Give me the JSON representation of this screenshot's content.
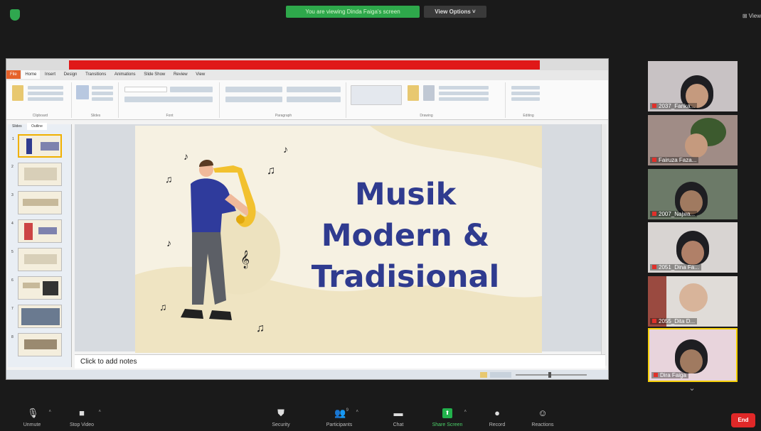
{
  "top": {
    "share_banner": "You are viewing Dinda Faiga's screen",
    "view_options": "View Options ˅",
    "view": "⊞ View"
  },
  "ppt": {
    "ribbon_tabs": [
      "File",
      "Home",
      "Insert",
      "Design",
      "Transitions",
      "Animations",
      "Slide Show",
      "Review",
      "View"
    ],
    "ribbon_groups": [
      "Clipboard",
      "Slides",
      "Font",
      "Paragraph",
      "Drawing",
      "Editing"
    ],
    "thumb_tabs": [
      "Slides",
      "Outline"
    ],
    "slide_numbers": [
      "1",
      "2",
      "3",
      "4",
      "5",
      "6",
      "7",
      "8"
    ],
    "slide_title_lines": [
      "Musik",
      "Modern &",
      "Tradisional"
    ],
    "notes_placeholder": "Click to add notes"
  },
  "participants": [
    {
      "name": "2037_Farika..."
    },
    {
      "name": "Fairuza Faza..."
    },
    {
      "name": "2007_Najwa..."
    },
    {
      "name": "2051_Dina Fa..."
    },
    {
      "name": "2055_Dita D..."
    },
    {
      "name": "Dira Faiga"
    }
  ],
  "toolbar": [
    {
      "label": "Unmute",
      "icon": "microphone-muted-icon",
      "caret": true
    },
    {
      "label": "Stop Video",
      "icon": "video-camera-icon",
      "caret": true
    },
    {
      "label": "Security",
      "icon": "shield-icon",
      "caret": false
    },
    {
      "label": "Participants",
      "icon": "participants-icon",
      "caret": true,
      "count": "9"
    },
    {
      "label": "Chat",
      "icon": "chat-icon",
      "caret": false
    },
    {
      "label": "Share Screen",
      "icon": "share-screen-icon",
      "caret": true
    },
    {
      "label": "Record",
      "icon": "record-icon",
      "caret": false
    },
    {
      "label": "Reactions",
      "icon": "reactions-icon",
      "caret": false
    }
  ],
  "end_label": "End",
  "colors": {
    "slide_title": "#2f3b8f",
    "share_banner": "#2ea84b",
    "end": "#e02828",
    "active_speaker": "#f5d000"
  }
}
